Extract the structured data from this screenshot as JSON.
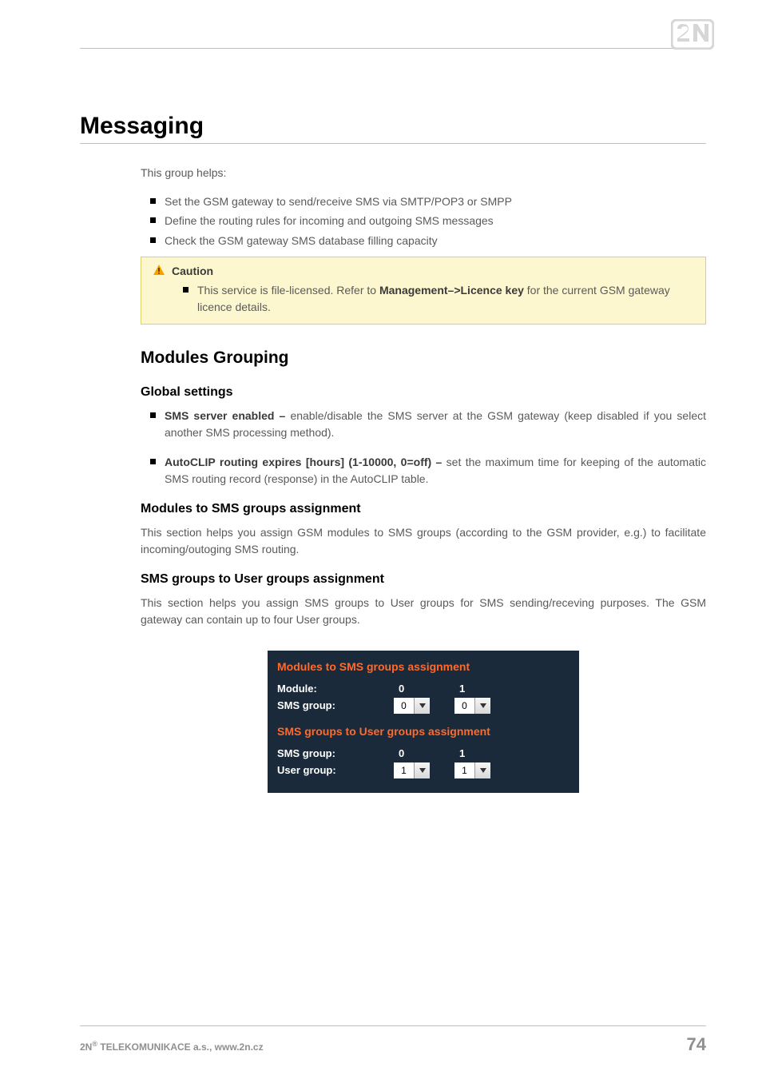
{
  "logo_alt": "2N",
  "h1": "Messaging",
  "lead": "This group helps:",
  "top_bullets": [
    "Set the GSM gateway to send/receive SMS via SMTP/POP3 or SMPP",
    "Define the routing rules for incoming and outgoing SMS messages",
    "Check the GSM gateway SMS database filling capacity"
  ],
  "callout": {
    "title": "Caution",
    "text_before": "This service is file-licensed. Refer to ",
    "bold": "Management–>Licence key",
    "text_after": " for the current GSM gateway licence details."
  },
  "h2": "Modules Grouping",
  "h3_global": "Global settings",
  "global_items": [
    {
      "bold": "SMS server enabled – ",
      "rest": "enable/disable the SMS server at the GSM gateway (keep disabled if you select another SMS processing method)."
    },
    {
      "bold": "AutoCLIP routing expires [hours] (1-10000, 0=off) – ",
      "rest": "set the maximum time for keeping of the automatic SMS routing record (response) in the AutoCLIP table."
    }
  ],
  "h3_modules": "Modules to SMS groups assignment",
  "modules_para": "This section helps you assign GSM modules to SMS groups (according to the GSM provider, e.g.) to facilitate incoming/outoging SMS routing.",
  "h3_smsgroups": "SMS groups to User groups assignment",
  "smsgroups_para": "This section helps you assign SMS groups to User groups for SMS sending/receving purposes. The GSM gateway can contain up to four User groups.",
  "panel": {
    "title1": "Modules to SMS groups assignment",
    "row1_label": "Module:",
    "row1_idx0": "0",
    "row1_idx1": "1",
    "row2_label": "SMS group:",
    "row2_sel0": "0",
    "row2_sel1": "0",
    "title2": "SMS groups to User groups assignment",
    "row3_label": "SMS group:",
    "row3_idx0": "0",
    "row3_idx1": "1",
    "row4_label": "User group:",
    "row4_sel0": "1",
    "row4_sel1": "1"
  },
  "footer": {
    "company_prefix": "2N",
    "company_sup": "®",
    "company_rest": " TELEKOMUNIKACE a.s., www.2n.cz",
    "page": "74"
  }
}
